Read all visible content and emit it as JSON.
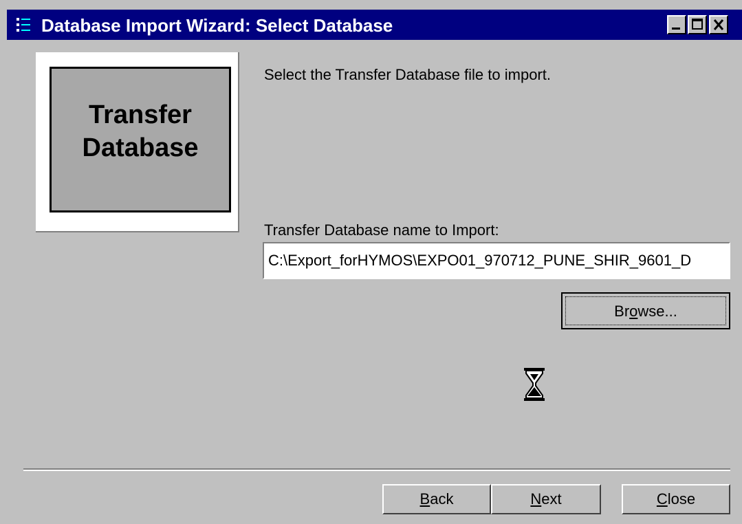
{
  "window": {
    "title": "Database Import Wizard: Select Database",
    "icon": "wizard-app-icon"
  },
  "logo": {
    "line1": "Transfer",
    "line2": "Database"
  },
  "instruction": "Select the Transfer Database file to import.",
  "field": {
    "label": "Transfer Database name to Import:",
    "value": "C:\\Export_forHYMOS\\EXPO01_970712_PUNE_SHIR_9601_D"
  },
  "buttons": {
    "browse_pre": "Br",
    "browse_ul": "o",
    "browse_post": "wse...",
    "back_ul": "B",
    "back_rest": "ack",
    "next_ul": "N",
    "next_rest": "ext",
    "close_ul": "C",
    "close_rest": "lose"
  },
  "colors": {
    "titlebar": "#000080",
    "face": "#c0c0c0",
    "logo_fill": "#a8a8a8"
  },
  "cursor": "hourglass-icon"
}
